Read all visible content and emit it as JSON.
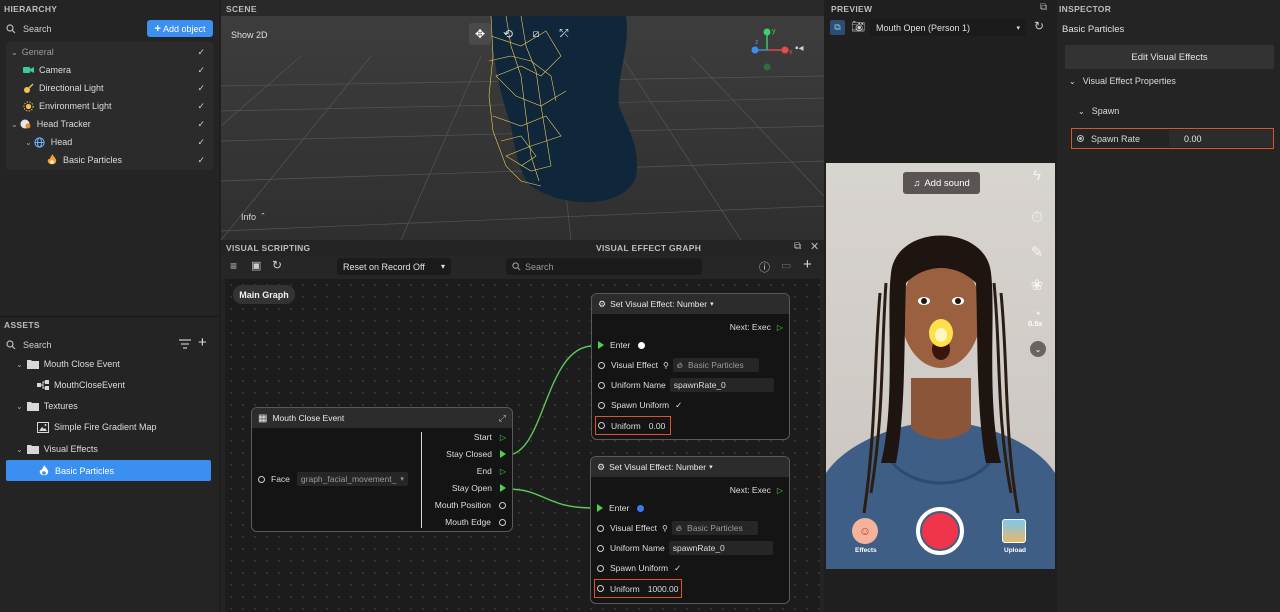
{
  "hierarchy": {
    "title": "HIERARCHY",
    "search_placeholder": "Search",
    "add_object": "Add object",
    "items": [
      {
        "label": "General",
        "icon": "chevron-down-icon"
      },
      {
        "label": "Camera",
        "icon": "camera-icon"
      },
      {
        "label": "Directional Light",
        "icon": "directional-light-icon"
      },
      {
        "label": "Environment Light",
        "icon": "sun-icon"
      },
      {
        "label": "Head Tracker",
        "icon": "head-tracker-icon"
      },
      {
        "label": "Head",
        "icon": "globe-icon"
      },
      {
        "label": "Basic Particles",
        "icon": "fire-icon"
      }
    ],
    "check": "✓"
  },
  "assets": {
    "title": "ASSETS",
    "search_placeholder": "Search",
    "items": [
      {
        "label": "Mouth Close Event",
        "icon": "folder-icon"
      },
      {
        "label": "MouthCloseEvent",
        "icon": "graph-icon"
      },
      {
        "label": "Textures",
        "icon": "folder-icon"
      },
      {
        "label": "Simple Fire Gradient Map",
        "icon": "image-icon"
      },
      {
        "label": "Visual Effects",
        "icon": "folder-icon"
      },
      {
        "label": "Basic Particles",
        "icon": "fire-icon"
      }
    ]
  },
  "scene": {
    "title": "SCENE",
    "show2d": "Show 2D",
    "info": "Info",
    "axes": {
      "y": "y",
      "z": "z",
      "x": "x"
    }
  },
  "scripting": {
    "title": "VISUAL SCRIPTING",
    "vfx_title": "VISUAL EFFECT GRAPH",
    "reset_label": "Reset on Record Off",
    "search_placeholder": "Search",
    "main_graph": "Main Graph",
    "event_node": {
      "title": "Mouth Close Event",
      "face_label": "Face",
      "face_value": "graph_facial_movement_",
      "outputs": [
        "Start",
        "Stay Closed",
        "End",
        "Stay Open",
        "Mouth Position",
        "Mouth Edge"
      ]
    },
    "set_nodes": [
      {
        "title": "Set Visual Effect: Number",
        "next": "Next: Exec",
        "enter": "Enter",
        "vfx_label": "Visual Effect",
        "vfx_value": "Basic Particles",
        "uname_label": "Uniform Name",
        "uname_value": "spawnRate_0",
        "spawn_label": "Spawn Uniform",
        "uniform_label": "Uniform",
        "uniform_value": "0.00",
        "enter_color": "#ffffff"
      },
      {
        "title": "Set Visual Effect: Number",
        "next": "Next: Exec",
        "enter": "Enter",
        "vfx_label": "Visual Effect",
        "vfx_value": "Basic Particles",
        "uname_label": "Uniform Name",
        "uname_value": "spawnRate_0",
        "spawn_label": "Spawn Uniform",
        "uniform_label": "Uniform",
        "uniform_value": "1000.00",
        "enter_color": "#3a7bf0"
      }
    ]
  },
  "preview": {
    "title": "PREVIEW",
    "mode": "Mouth Open (Person 1)",
    "add_sound": "Add sound",
    "speed": "0.5x",
    "effects": "Effects",
    "upload": "Upload"
  },
  "inspector": {
    "title": "INSPECTOR",
    "object": "Basic Particles",
    "edit_button": "Edit Visual Effects",
    "section": "Visual Effect Properties",
    "subsection": "Spawn",
    "prop_label": "Spawn Rate",
    "prop_value": "0.00"
  },
  "colors": {
    "accent": "#3b8ff0",
    "highlight": "#e0522d",
    "record": "#f0344a",
    "wire": "#5bc85b"
  }
}
